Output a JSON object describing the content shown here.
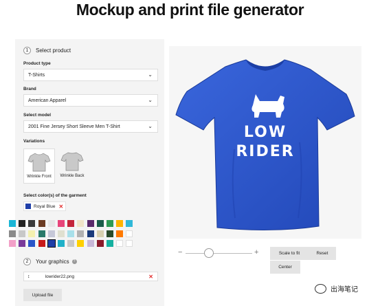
{
  "page": {
    "title": "Mockup and print file generator"
  },
  "product_step": {
    "number": "1",
    "title": "Select product"
  },
  "product_type": {
    "label": "Product type",
    "value": "T-Shirts"
  },
  "brand": {
    "label": "Brand",
    "value": "American Apparel"
  },
  "model": {
    "label": "Select model",
    "value": "2001 Fine Jersey Short Sleeve Men T-Shirt"
  },
  "variations": {
    "label": "Variations",
    "items": [
      {
        "label": "Wrinkle Front",
        "active": true
      },
      {
        "label": "Wrinkle Back",
        "active": false
      }
    ]
  },
  "garment_color": {
    "label": "Select color(s) of the garment",
    "selected": {
      "name": "Royal Blue",
      "hex": "#1f3fa8"
    },
    "swatches": [
      "#1ab6d6",
      "#222222",
      "#3a3a3a",
      "#6b3b22",
      "#e6e6e6",
      "#e8457a",
      "#c4243a",
      "#f0e4c8",
      "#5a2a6b",
      "#1a5c4a",
      "#2f9a55",
      "#ffb400",
      "#30b8d8",
      "#8a8a8a",
      "#c8c8c8",
      "#f4f0b0",
      "#2a7a6a",
      "#c6c8d8",
      "#e0e0d0",
      "#a8e0ea",
      "#b2b2b2",
      "#1a3a7a",
      "#d8d0b0",
      "#2a4a2a",
      "#ff7a00",
      "#ffffff",
      "#f2a0c8",
      "#7a3a9a",
      "#2a55c8",
      "#c81a1a",
      "#1f3fa8",
      "#20b0c8",
      "#c8c8c8",
      "#ffd000",
      "#c8b8d8",
      "#8a1a2a",
      "#16b0a0",
      "#ffffff",
      "#ffffff"
    ],
    "selected_index": 30
  },
  "graphics_step": {
    "number": "2",
    "title": "Your graphics",
    "help_icon": "info-icon"
  },
  "file": {
    "name": "lowrider22.png"
  },
  "upload_label": "Upload file",
  "preview": {
    "shirt_color": "#2f5bd2",
    "print_text_line1": "LOW",
    "print_text_line2": "RIDER"
  },
  "zoom": {
    "minus": "−",
    "plus": "+",
    "level": 0.35
  },
  "tools": {
    "scale_label": "Scale to fit",
    "reset_label": "Reset",
    "center_label": "Center"
  },
  "watermark": {
    "text": "出海笔记"
  }
}
